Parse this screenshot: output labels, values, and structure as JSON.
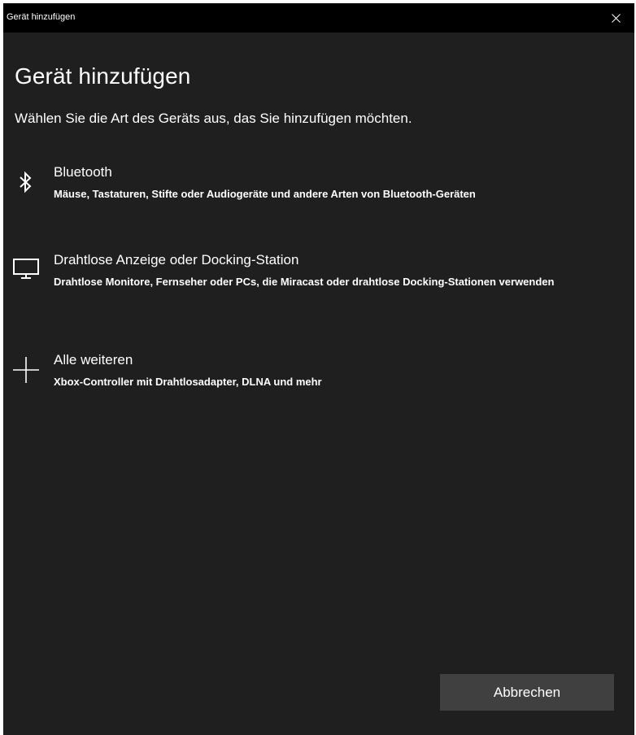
{
  "window": {
    "title": "Gerät hinzufügen"
  },
  "page": {
    "title": "Gerät hinzufügen",
    "subtitle": "Wählen Sie die Art des Geräts aus, das Sie hinzufügen möchten."
  },
  "options": [
    {
      "icon": "bluetooth-icon",
      "title": "Bluetooth",
      "description": "Mäuse, Tastaturen, Stifte oder Audiogeräte und andere Arten von Bluetooth-Geräten"
    },
    {
      "icon": "monitor-icon",
      "title": "Drahtlose Anzeige oder Docking-Station",
      "description": "Drahtlose Monitore, Fernseher oder PCs, die Miracast oder drahtlose Docking-Stationen verwenden"
    },
    {
      "icon": "plus-icon",
      "title": "Alle weiteren",
      "description": "Xbox-Controller mit Drahtlosadapter, DLNA und mehr"
    }
  ],
  "footer": {
    "cancel_label": "Abbrechen"
  },
  "colors": {
    "background": "#1f1f1f",
    "titlebar": "#000000",
    "text": "#ffffff",
    "button": "#404040"
  }
}
